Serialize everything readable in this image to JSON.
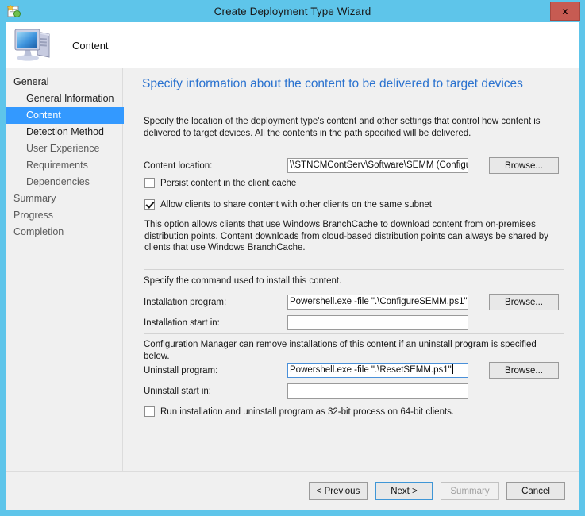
{
  "window": {
    "title": "Create Deployment Type Wizard",
    "close_label": "x",
    "app_icon": "wizard-document-icon"
  },
  "header": {
    "title": "Content",
    "icon": "computer-monitor-icon"
  },
  "sidebar": {
    "items": [
      {
        "label": "General",
        "level": 0,
        "selected": false,
        "dim": false
      },
      {
        "label": "General Information",
        "level": 1,
        "selected": false,
        "dim": false
      },
      {
        "label": "Content",
        "level": 1,
        "selected": true,
        "dim": false
      },
      {
        "label": "Detection Method",
        "level": 1,
        "selected": false,
        "dim": false
      },
      {
        "label": "User Experience",
        "level": 1,
        "selected": false,
        "dim": true
      },
      {
        "label": "Requirements",
        "level": 1,
        "selected": false,
        "dim": true
      },
      {
        "label": "Dependencies",
        "level": 1,
        "selected": false,
        "dim": true
      },
      {
        "label": "Summary",
        "level": 0,
        "selected": false,
        "dim": true
      },
      {
        "label": "Progress",
        "level": 0,
        "selected": false,
        "dim": true
      },
      {
        "label": "Completion",
        "level": 0,
        "selected": false,
        "dim": true
      }
    ]
  },
  "main": {
    "heading": "Specify information about the content to be delivered to target devices",
    "intro": "Specify the location of the deployment type's content and other settings that control how content is delivered to target devices. All the contents in the path specified will be delivered.",
    "content_location": {
      "label": "Content location:",
      "value": "\\\\STNCMContServ\\Software\\SEMM (Configuratio",
      "browse_label": "Browse..."
    },
    "persist_checkbox": {
      "label": "Persist content in the client cache",
      "checked": false
    },
    "share_checkbox": {
      "label": "Allow clients to share content with other clients on the same subnet",
      "checked": true
    },
    "branchcache_note": "This option allows clients that use Windows BranchCache to download content from on-premises distribution points. Content downloads from cloud-based distribution points can always be shared by clients that use Windows BranchCache.",
    "install_section_note": "Specify the command used to install this content.",
    "installation_program": {
      "label": "Installation program:",
      "value": "Powershell.exe -file \".\\ConfigureSEMM.ps1\"",
      "browse_label": "Browse..."
    },
    "installation_start_in": {
      "label": "Installation start in:",
      "value": ""
    },
    "uninstall_section_note": "Configuration Manager can remove installations of this content if an uninstall program is specified below.",
    "uninstall_program": {
      "label": "Uninstall program:",
      "value": "Powershell.exe -file \".\\ResetSEMM.ps1\"",
      "browse_label": "Browse..."
    },
    "uninstall_start_in": {
      "label": "Uninstall start in:",
      "value": ""
    },
    "bit32_checkbox": {
      "label": "Run installation and uninstall program as 32-bit process on 64-bit clients.",
      "checked": false
    }
  },
  "footer": {
    "previous": "< Previous",
    "next": "Next >",
    "summary": "Summary",
    "cancel": "Cancel"
  },
  "colors": {
    "title_bar": "#5ec5ea",
    "accent_heading": "#2a72cf",
    "selection": "#3399ff",
    "close_button": "#c75b52",
    "panel": "#f0f0f0"
  }
}
